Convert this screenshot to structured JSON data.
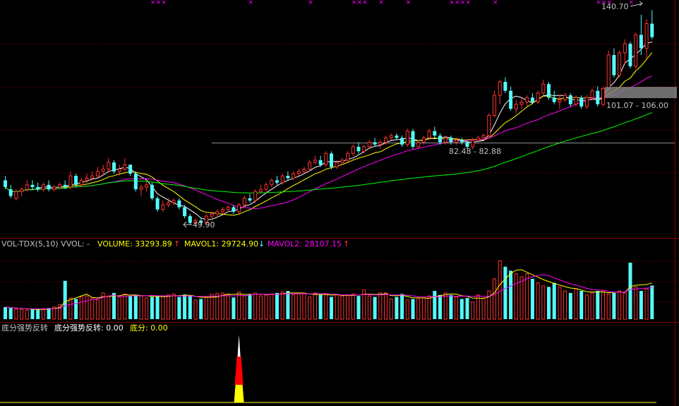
{
  "colors": {
    "bg": "#000000",
    "grid": "#800000",
    "up": "#ff3232",
    "down": "#54fcfc",
    "ma_white": "#ffffff",
    "ma_yellow": "#ffff00",
    "ma_magenta": "#ff00ff",
    "ma_green": "#00ff00",
    "text": "#c0c0c0",
    "label_yellow": "#ffff00",
    "label_magenta": "#ff00ff",
    "marker": "#ff00ff"
  },
  "price_panel": {
    "high_label": "140.70",
    "low_label": "49.90",
    "range_label_1": "82.48 - 82.88",
    "range_label_2": "101.07 - 106.00",
    "ylim": [
      45,
      145
    ],
    "reference_lines": [
      82.7,
      106.0
    ]
  },
  "vol_panel": {
    "name": "VOL-TDX(5,10) VVOL: -",
    "volume_label": "VOLUME: 33293.89",
    "volume_arrow": "↑",
    "mavol1_label": "MAVOL1: 29724.90",
    "mavol1_arrow": "↓",
    "mavol2_label": "MAVOL2: 28107.15",
    "mavol2_arrow": "↑",
    "ylim": [
      0,
      70000
    ]
  },
  "ind_panel": {
    "title": "底分强势反转",
    "line1_label": "底分强势反转: 0.00",
    "line2_label": "底分: 0.00",
    "spike_index": 43
  },
  "top_markers": [
    27,
    28,
    29,
    45,
    56,
    64,
    65,
    66,
    69,
    74,
    82,
    83,
    84,
    85,
    90,
    109,
    110,
    111,
    115
  ],
  "chart_data": {
    "type": "candlestick",
    "title": "",
    "series": [
      {
        "name": "K",
        "ohlc": [
          [
            66,
            68,
            62,
            63
          ],
          [
            62,
            64,
            58,
            59
          ],
          [
            58,
            62,
            57,
            61
          ],
          [
            61,
            63,
            59,
            62
          ],
          [
            62,
            66,
            61,
            64
          ],
          [
            64,
            66,
            62,
            63
          ],
          [
            63,
            65,
            61,
            62
          ],
          [
            62,
            65,
            61,
            64
          ],
          [
            64,
            66,
            61,
            62
          ],
          [
            62,
            64,
            61,
            63
          ],
          [
            63,
            65,
            62,
            64
          ],
          [
            64,
            66,
            62,
            63
          ],
          [
            63,
            70,
            62,
            68
          ],
          [
            68,
            69,
            63,
            64
          ],
          [
            64,
            67,
            63,
            66
          ],
          [
            66,
            69,
            65,
            67
          ],
          [
            67,
            70,
            66,
            68
          ],
          [
            68,
            72,
            67,
            70
          ],
          [
            70,
            73,
            68,
            71
          ],
          [
            71,
            76,
            70,
            74
          ],
          [
            74,
            75,
            69,
            70
          ],
          [
            70,
            73,
            68,
            71
          ],
          [
            71,
            76,
            70,
            73
          ],
          [
            73,
            73,
            68,
            69
          ],
          [
            69,
            70,
            61,
            62
          ],
          [
            62,
            64,
            59,
            63
          ],
          [
            63,
            66,
            61,
            64
          ],
          [
            64,
            65,
            57,
            58
          ],
          [
            58,
            59,
            52,
            53
          ],
          [
            53,
            57,
            52,
            55
          ],
          [
            55,
            58,
            54,
            56
          ],
          [
            56,
            58,
            55,
            57
          ],
          [
            57,
            58,
            53,
            54
          ],
          [
            54,
            55,
            49,
            50
          ],
          [
            50,
            51,
            46,
            47
          ],
          [
            47,
            49,
            46,
            48
          ],
          [
            48,
            49,
            46,
            47
          ],
          [
            47,
            51,
            46,
            50
          ],
          [
            50,
            52,
            49,
            51
          ],
          [
            51,
            53,
            50,
            52
          ],
          [
            52,
            54,
            51,
            53
          ],
          [
            53,
            55,
            52,
            54
          ],
          [
            54,
            55,
            51,
            52
          ],
          [
            52,
            56,
            51,
            55
          ],
          [
            55,
            59,
            54,
            58
          ],
          [
            58,
            60,
            56,
            57
          ],
          [
            57,
            62,
            56,
            61
          ],
          [
            61,
            64,
            60,
            62
          ],
          [
            62,
            65,
            61,
            64
          ],
          [
            64,
            67,
            63,
            66
          ],
          [
            66,
            68,
            64,
            65
          ],
          [
            65,
            69,
            64,
            68
          ],
          [
            68,
            70,
            66,
            67
          ],
          [
            67,
            70,
            66,
            69
          ],
          [
            69,
            71,
            68,
            70
          ],
          [
            70,
            72,
            69,
            71
          ],
          [
            71,
            75,
            70,
            74
          ],
          [
            74,
            77,
            73,
            75
          ],
          [
            75,
            77,
            72,
            73
          ],
          [
            73,
            79,
            72,
            78
          ],
          [
            78,
            79,
            71,
            72
          ],
          [
            72,
            75,
            71,
            74
          ],
          [
            74,
            76,
            73,
            75
          ],
          [
            75,
            79,
            74,
            78
          ],
          [
            78,
            82,
            77,
            81
          ],
          [
            81,
            83,
            78,
            79
          ],
          [
            79,
            82,
            78,
            81
          ],
          [
            81,
            84,
            80,
            83
          ],
          [
            83,
            85,
            81,
            82
          ],
          [
            82,
            84,
            80,
            83
          ],
          [
            83,
            86,
            82,
            85
          ],
          [
            85,
            87,
            84,
            86
          ],
          [
            86,
            87,
            84,
            85
          ],
          [
            85,
            86,
            81,
            82
          ],
          [
            82,
            89,
            81,
            88
          ],
          [
            88,
            89,
            80,
            81
          ],
          [
            81,
            84,
            80,
            83
          ],
          [
            83,
            86,
            82,
            85
          ],
          [
            85,
            89,
            84,
            88
          ],
          [
            88,
            90,
            85,
            86
          ],
          [
            86,
            87,
            82,
            83
          ],
          [
            83,
            86,
            82,
            85
          ],
          [
            85,
            86,
            82,
            83
          ],
          [
            83,
            85,
            82,
            84
          ],
          [
            84,
            85,
            82,
            83
          ],
          [
            83,
            84,
            80,
            81
          ],
          [
            81,
            85,
            80,
            84
          ],
          [
            84,
            86,
            83,
            85
          ],
          [
            85,
            87,
            84,
            86
          ],
          [
            86,
            96,
            85,
            95
          ],
          [
            95,
            106,
            94,
            104
          ],
          [
            104,
            111,
            100,
            110
          ],
          [
            110,
            112,
            105,
            106
          ],
          [
            106,
            108,
            97,
            98
          ],
          [
            98,
            102,
            96,
            100
          ],
          [
            100,
            103,
            98,
            101
          ],
          [
            101,
            104,
            99,
            103
          ],
          [
            103,
            105,
            100,
            101
          ],
          [
            101,
            106,
            100,
            105
          ],
          [
            105,
            111,
            104,
            109
          ],
          [
            109,
            110,
            102,
            103
          ],
          [
            103,
            106,
            100,
            101
          ],
          [
            101,
            104,
            98,
            102
          ],
          [
            102,
            105,
            101,
            104
          ],
          [
            104,
            105,
            99,
            100
          ],
          [
            100,
            104,
            99,
            103
          ],
          [
            103,
            104,
            98,
            99
          ],
          [
            99,
            104,
            98,
            103
          ],
          [
            103,
            107,
            102,
            106
          ],
          [
            106,
            108,
            99,
            100
          ],
          [
            100,
            108,
            99,
            107
          ],
          [
            107,
            124,
            106,
            122
          ],
          [
            122,
            125,
            112,
            113
          ],
          [
            113,
            124,
            112,
            123
          ],
          [
            123,
            129,
            118,
            127
          ],
          [
            127,
            128,
            116,
            117
          ],
          [
            117,
            132,
            116,
            131
          ],
          [
            131,
            140,
            122,
            125
          ],
          [
            125,
            138,
            120,
            136
          ],
          [
            136,
            142,
            129,
            130
          ]
        ]
      },
      {
        "name": "MA5",
        "color": "white"
      },
      {
        "name": "MA10",
        "color": "yellow"
      },
      {
        "name": "MA20",
        "color": "magenta"
      },
      {
        "name": "MA60",
        "color": "green"
      },
      {
        "name": "VOLUME",
        "values": [
          12000,
          11000,
          10000,
          9500,
          9000,
          10000,
          9500,
          10500,
          11000,
          12000,
          14500,
          38000,
          21000,
          20000,
          22000,
          23000,
          21000,
          19000,
          26000,
          23000,
          26000,
          22000,
          25000,
          23000,
          24000,
          23000,
          21000,
          22000,
          23000,
          22500,
          24000,
          25000,
          22000,
          24500,
          23000,
          19000,
          20000,
          22000,
          24500,
          25500,
          26000,
          25000,
          21500,
          27000,
          23000,
          25000,
          26000,
          23000,
          24000,
          25000,
          26000,
          27000,
          28000,
          24000,
          25000,
          25500,
          22000,
          26000,
          24000,
          25000,
          22000,
          24000,
          23000,
          24000,
          25000,
          23000,
          29000,
          23000,
          22000,
          26000,
          26000,
          20000,
          22000,
          25000,
          19000,
          20000,
          20000,
          21000,
          23000,
          28000,
          24000,
          26000,
          24000,
          22000,
          20000,
          21000,
          17000,
          24000,
          21000,
          28000,
          40000,
          58000,
          52000,
          48000,
          45000,
          42000,
          45000,
          40000,
          36000,
          33000,
          32000,
          36000,
          32000,
          28000,
          26000,
          30000,
          28000,
          24000,
          26000,
          28000,
          28000,
          25000,
          26000,
          28000,
          26000,
          56000,
          32000,
          28000,
          30000,
          33294
        ]
      },
      {
        "name": "MAVOL1",
        "color": "yellow"
      },
      {
        "name": "MAVOL2",
        "color": "magenta"
      }
    ]
  }
}
